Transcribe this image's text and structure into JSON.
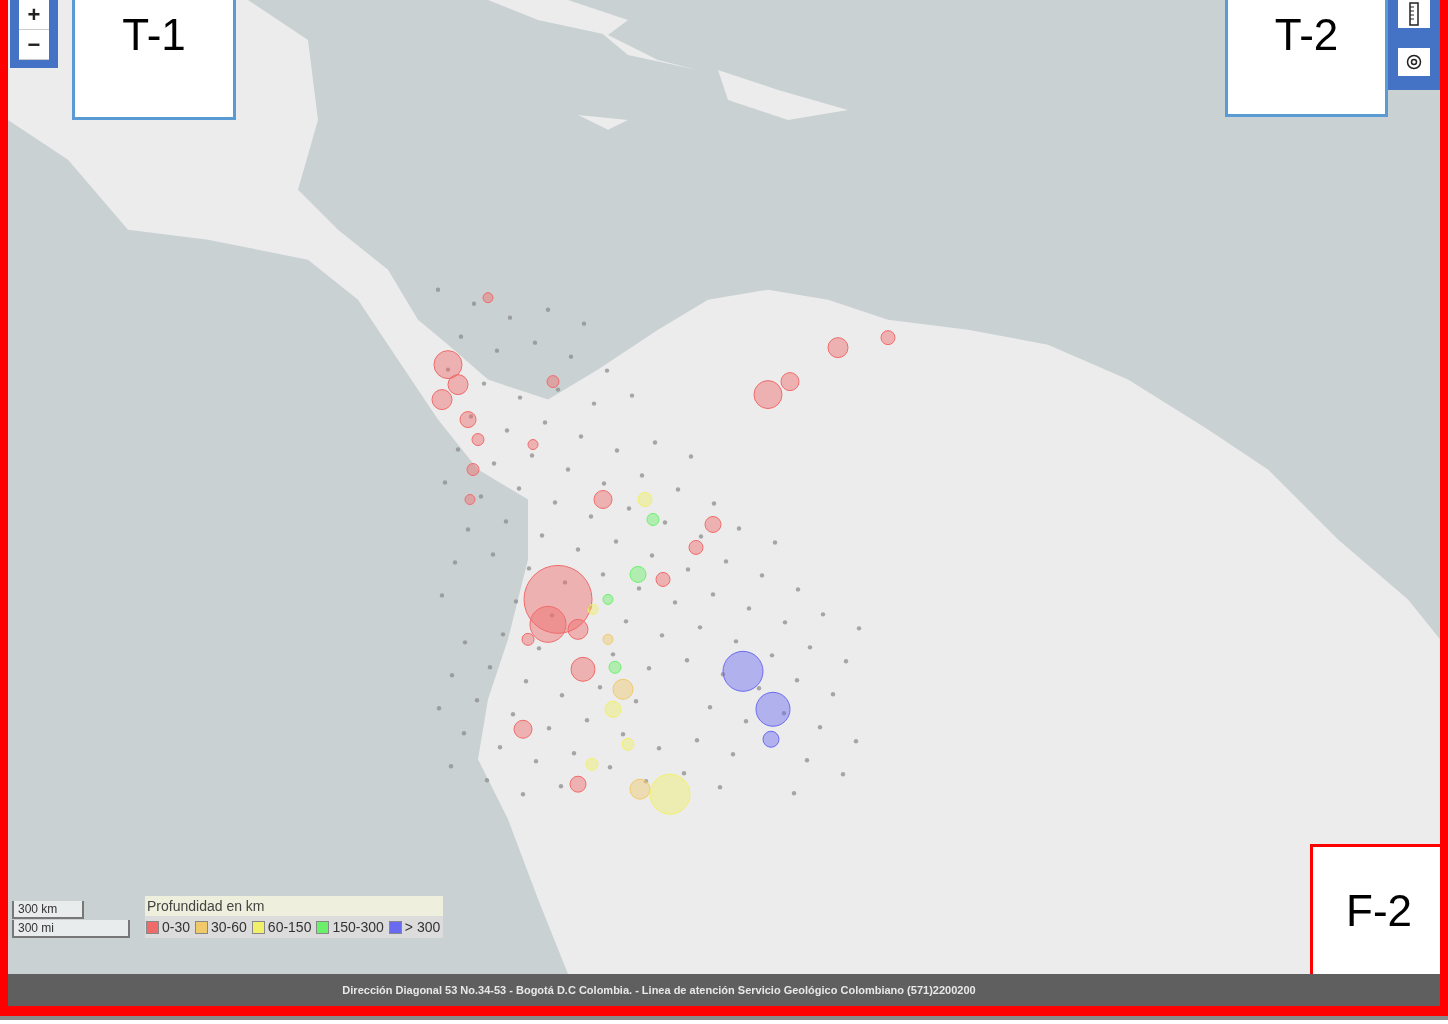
{
  "zoom_controls": {
    "zoom_in": "+",
    "zoom_out": "−"
  },
  "annotations": [
    {
      "label": "T-1",
      "color": "#5b9bd5"
    },
    {
      "label": "T-2",
      "color": "#5b9bd5"
    },
    {
      "label": "F-2",
      "color": "#ff0000"
    }
  ],
  "scale": [
    "300 km",
    "300 mi"
  ],
  "legend": {
    "title": "Profundidad en km",
    "items": [
      {
        "label": "0-30",
        "color": "#f06a6a"
      },
      {
        "label": "30-60",
        "color": "#f0c96a"
      },
      {
        "label": "60-150",
        "color": "#f0f06a"
      },
      {
        "label": "150-300",
        "color": "#6af06a"
      },
      {
        "label": "> 300",
        "color": "#6a6af0"
      }
    ]
  },
  "footer": "Dirección Diagonal 53 No.34-53 - Bogotá D.C Colombia. - Linea de atención Servicio Geológico Colombiano (571)2200200"
}
